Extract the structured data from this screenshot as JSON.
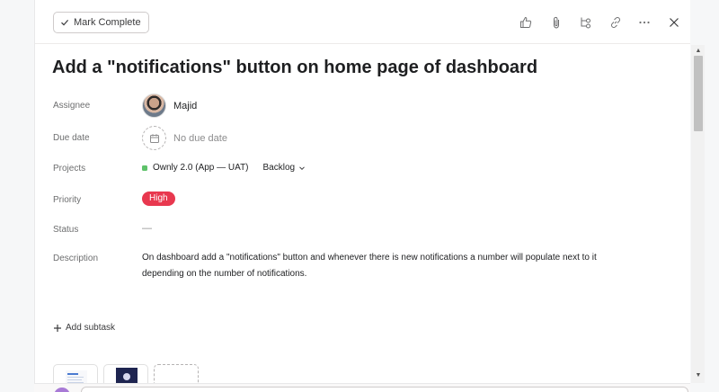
{
  "toolbar": {
    "mark_complete_label": "Mark Complete",
    "icons": [
      "thumbs-up-icon",
      "attachment-icon",
      "subtask-icon",
      "link-icon",
      "more-icon",
      "close-icon"
    ]
  },
  "task": {
    "title": "Add a \"notifications\" button on home page of dashboard"
  },
  "fields": {
    "assignee": {
      "label": "Assignee",
      "value": "Majid"
    },
    "due_date": {
      "label": "Due date",
      "value": "No due date"
    },
    "projects": {
      "label": "Projects",
      "project": "Ownly 2.0 (App — UAT)",
      "section": "Backlog",
      "project_color": "#5ec26a"
    },
    "priority": {
      "label": "Priority",
      "value": "High",
      "color": "#e8384f"
    },
    "status": {
      "label": "Status",
      "value": "—"
    },
    "description": {
      "label": "Description",
      "line1": "On dashboard add a \"notifications\" button and whenever there is new notifications a number will populate next to it",
      "line2": "depending on the number of notifications."
    }
  },
  "subtasks": {
    "add_label": "Add subtask"
  },
  "scrollbar": {
    "up": "▲",
    "down": "▼"
  }
}
